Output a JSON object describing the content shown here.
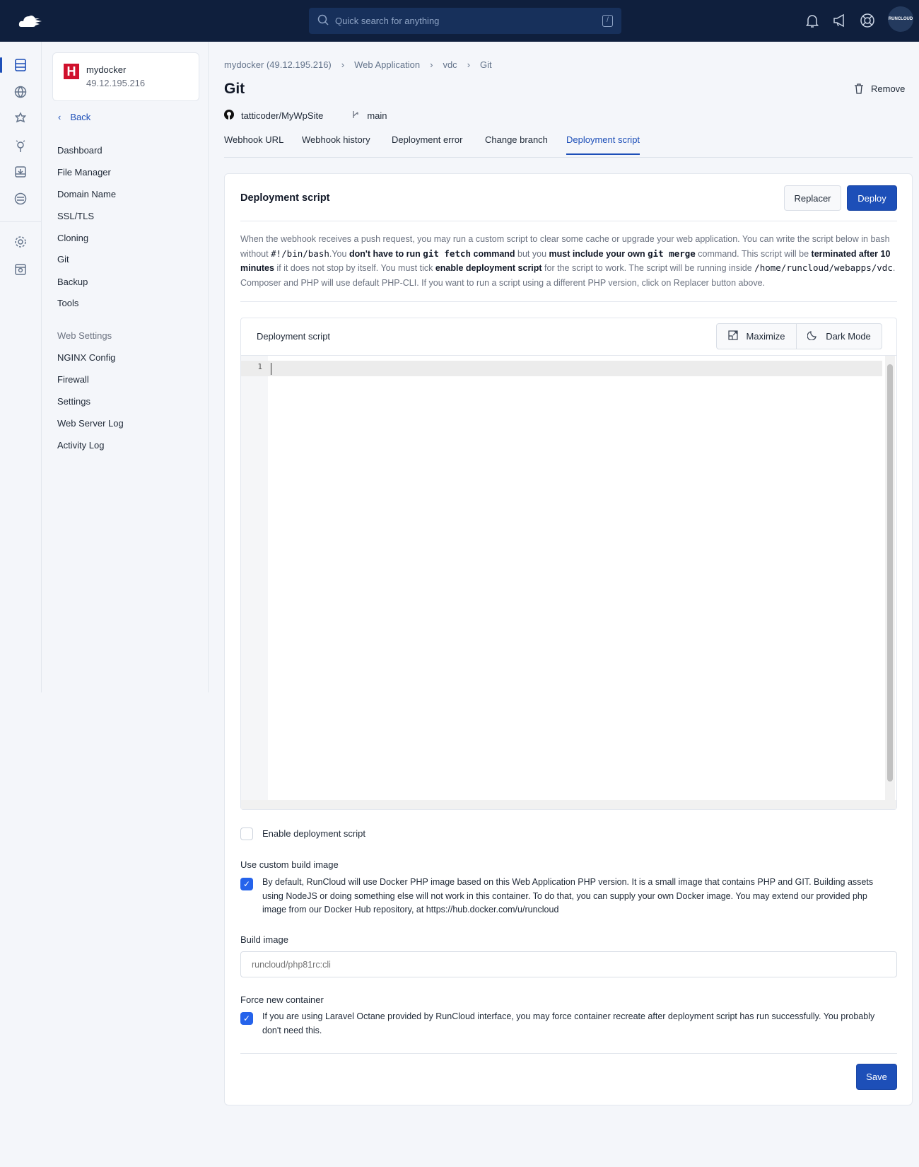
{
  "topbar": {
    "search_placeholder": "Quick search for anything",
    "search_shortcut": "/",
    "avatar_text": "RUNCLOUD"
  },
  "server": {
    "name": "mydocker",
    "ip": "49.12.195.216"
  },
  "sidebar": {
    "back": "Back",
    "items": [
      "Dashboard",
      "File Manager",
      "Domain Name",
      "SSL/TLS",
      "Cloning",
      "Git",
      "Backup",
      "Tools"
    ],
    "section": "Web Settings",
    "items2": [
      "NGINX Config",
      "Firewall",
      "Settings",
      "Web Server Log",
      "Activity Log"
    ]
  },
  "breadcrumb": [
    "mydocker (49.12.195.216)",
    "Web Application",
    "vdc",
    "Git"
  ],
  "page": {
    "title": "Git",
    "remove": "Remove",
    "repo": "tatticoder/MyWpSite",
    "branch": "main"
  },
  "tabs": [
    {
      "label": "Webhook URL"
    },
    {
      "label": "Webhook history"
    },
    {
      "label": "Deployment error"
    },
    {
      "label": "Change branch"
    },
    {
      "label": "Deployment script",
      "active": true
    }
  ],
  "card": {
    "title": "Deployment script",
    "replacer": "Replacer",
    "deploy": "Deploy",
    "desc": {
      "t1": "When the webhook receives a push request, you may run a custom script to clear some cache or upgrade your web application. You can write the script below in bash without ",
      "c1": "#!/bin/bash",
      "t2": ".You ",
      "b1": "don't have to run ",
      "c2": "git fetch",
      "b2": " command",
      "t3": " but you ",
      "b3": "must include your own ",
      "c3": "git merge",
      "t4": " command. This script will be ",
      "b4": "terminated after 10 minutes",
      "t5": " if it does not stop by itself. You must tick ",
      "b5": "enable deployment script",
      "t6": " for the script to work. The script will be running inside ",
      "c4": "/home/runcloud/webapps/vdc",
      "t7": ". Composer and PHP will use default PHP-CLI. If you want to run a script using a different PHP version, click on Replacer button above."
    },
    "editor": {
      "title": "Deployment script",
      "maximize": "Maximize",
      "dark_mode": "Dark Mode",
      "line_number": "1",
      "content": ""
    },
    "enable_label": "Enable deployment script",
    "enable_checked": false,
    "custom_image": {
      "label": "Use custom build image",
      "checked": true,
      "text": "By default, RunCloud will use Docker PHP image based on this Web Application PHP version. It is a small image that contains PHP and GIT. Building assets using NodeJS or doing something else will not work in this container. To do that, you can supply your own Docker image. You may extend our provided php image from our Docker Hub repository, at https://hub.docker.com/u/runcloud"
    },
    "build_image": {
      "label": "Build image",
      "placeholder": "runcloud/php81rc:cli"
    },
    "force": {
      "label": "Force new container",
      "checked": true,
      "text": "If you are using Laravel Octane provided by RunCloud interface, you may force container recreate after deployment script has run successfully. You probably don't need this."
    },
    "save": "Save"
  },
  "colors": {
    "accent": "#1d4fb8",
    "header": "#0f1f3d"
  }
}
